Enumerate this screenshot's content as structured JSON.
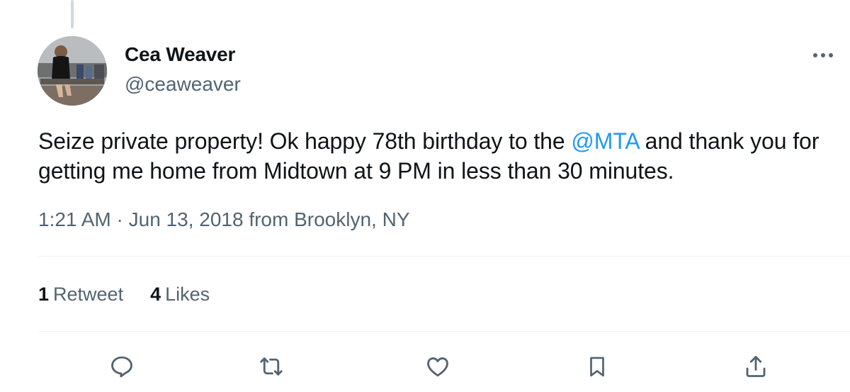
{
  "tweet": {
    "author": {
      "display_name": "Cea Weaver",
      "handle": "@ceaweaver"
    },
    "text": {
      "part1": "Seize private property! Ok happy 78th birthday to the ",
      "mention": "@MTA",
      "part2": " and thank you for getting me home from Midtown at 9 PM in less than 30 minutes."
    },
    "meta": {
      "time": "1:21 AM",
      "separator": " · ",
      "date": "Jun 13, 2018",
      "from_prefix": " from ",
      "location": "Brooklyn, NY"
    },
    "stats": {
      "retweets_count": "1",
      "retweets_label": "Retweet",
      "likes_count": "4",
      "likes_label": "Likes"
    },
    "actions": [
      {
        "icon": "reply-icon"
      },
      {
        "icon": "retweet-icon"
      },
      {
        "icon": "like-icon"
      },
      {
        "icon": "bookmark-icon"
      },
      {
        "icon": "share-icon"
      }
    ]
  },
  "colors": {
    "text": "#0f1419",
    "secondary": "#536471",
    "link": "#1d9bf0",
    "divider": "#eff3f4"
  }
}
